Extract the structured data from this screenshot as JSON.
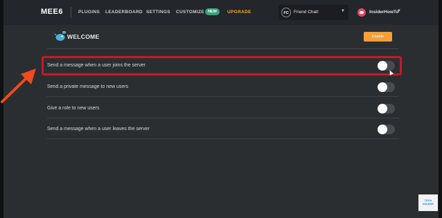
{
  "nav": {
    "logo": "MEE6",
    "links": {
      "plugins": "PLUGINS",
      "leaderboard": "LEADERBOARD",
      "settings": "SETTINGS",
      "customize": "CUSTOMIZE",
      "upgrade": "UPGRADE"
    },
    "customize_badge": "NEW",
    "server": {
      "initials": "FC",
      "name": "Friend Chat!"
    },
    "user": {
      "name": "InsiderHowTo"
    }
  },
  "section": {
    "title": "WELCOME",
    "enable_label": "Enable"
  },
  "options": [
    {
      "label": "Send a message when a user joins the server",
      "enabled": false
    },
    {
      "label": "Send a private message to new users",
      "enabled": false
    },
    {
      "label": "Give a role to new users",
      "enabled": false
    },
    {
      "label": "Send a message when a user leaves the server",
      "enabled": false
    }
  ],
  "watermark": {
    "line1": "TECH",
    "line2": "INSIDER"
  },
  "colors": {
    "background": "#2b2e31",
    "nav": "#23262a",
    "upgrade": "#f0a930",
    "new_badge": "#3aa37d",
    "enable_button": "#f3a03b",
    "highlight": "#c8182a",
    "arrow": "#f04a1e"
  },
  "icons": [
    "chevron-down-icon",
    "discord-avatar-icon",
    "welcome-bird-icon",
    "annotation-arrow-icon",
    "mouse-cursor-icon"
  ]
}
